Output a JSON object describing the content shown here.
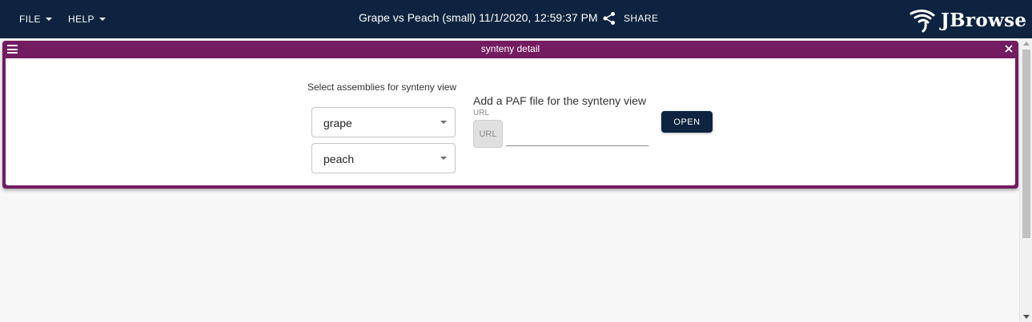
{
  "appbar": {
    "menus": [
      {
        "label": "FILE"
      },
      {
        "label": "HELP"
      }
    ],
    "session_title": "Grape vs Peach (small) 11/1/2020, 12:59:37 PM",
    "share_label": "SHARE",
    "logo_text": "JBrowse"
  },
  "view": {
    "title": "synteny detail",
    "assembly_prompt": "Select assemblies for synteny view",
    "assemblies": [
      {
        "selected": "grape"
      },
      {
        "selected": "peach"
      }
    ],
    "paf_prompt": "Add a PAF file for the synteny view",
    "url_label": "URL",
    "url_toggle_label": "URL",
    "url_value": "",
    "open_label": "OPEN"
  },
  "colors": {
    "appbar": "#0d233f",
    "view_header": "#731c60",
    "open_button": "#0d233f"
  },
  "icons": [
    "caret-down-icon",
    "share-icon",
    "jbrowse-logo-icon",
    "hamburger-menu-icon",
    "close-icon"
  ]
}
